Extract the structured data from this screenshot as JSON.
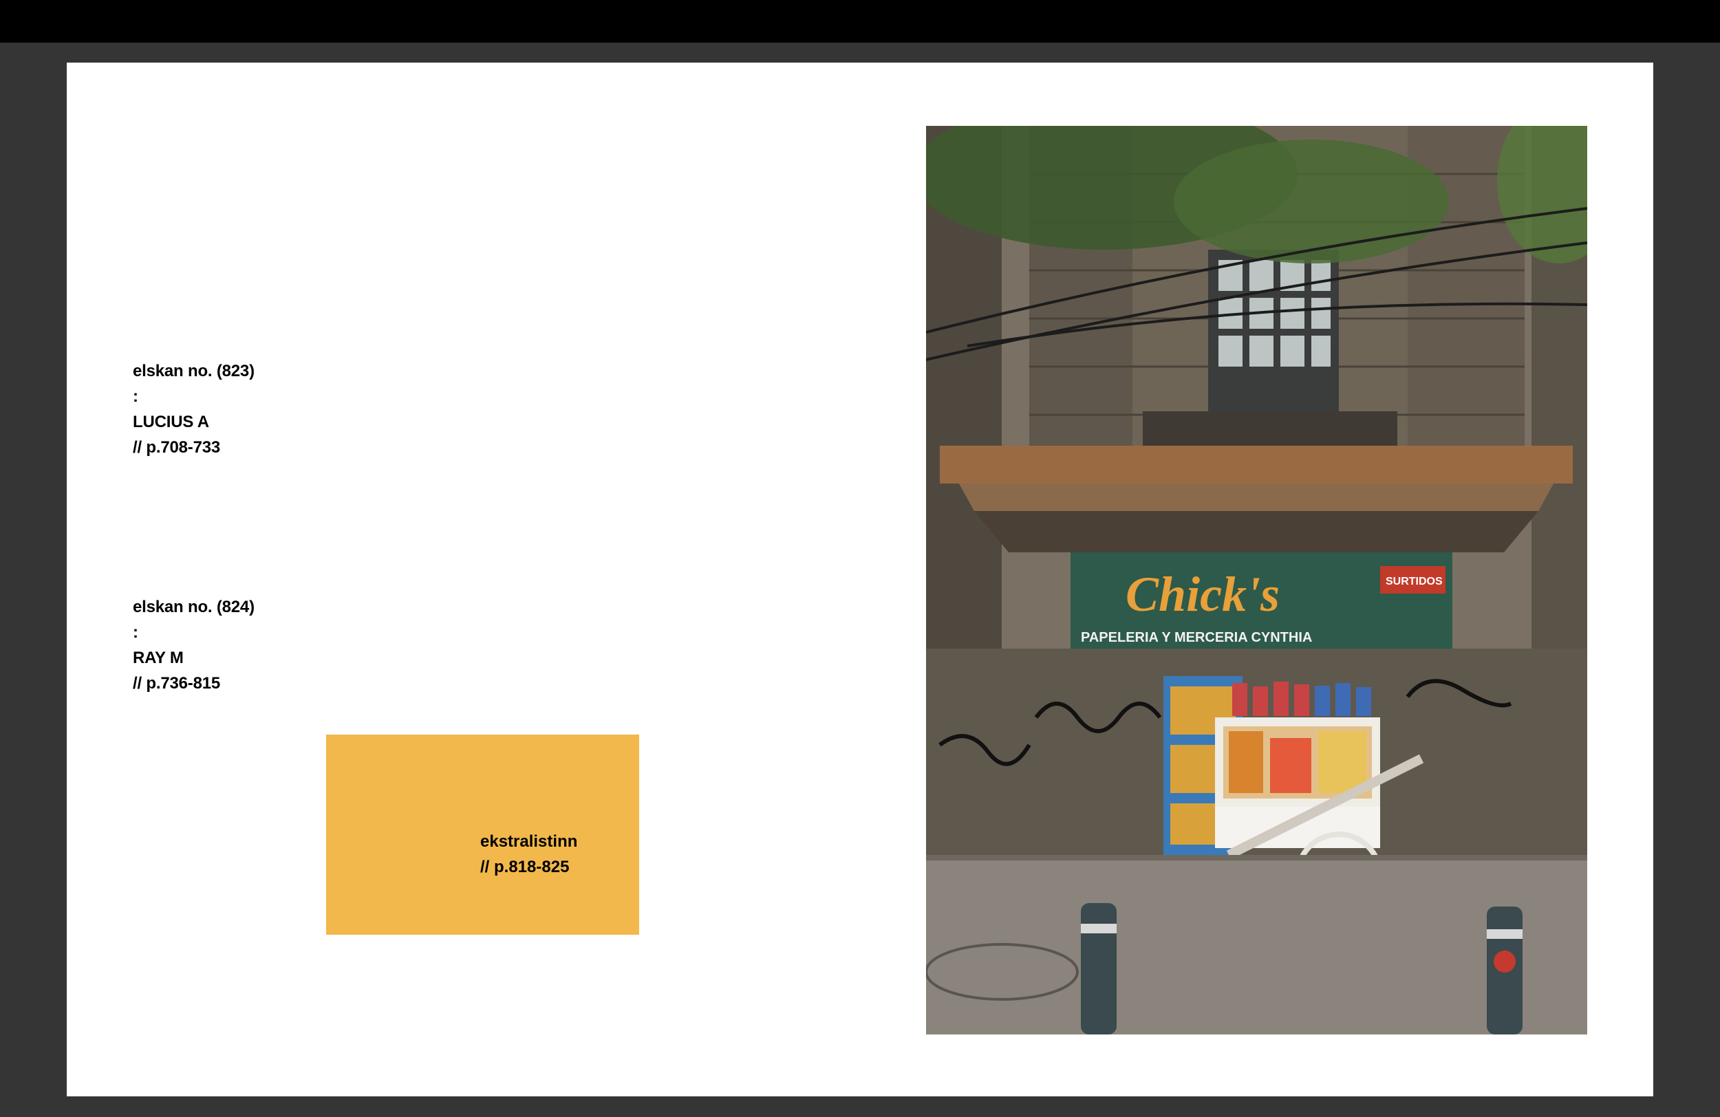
{
  "entries": [
    {
      "line1": "elskan no. (823)",
      "line2": ":",
      "name": "LUCIUS A",
      "pages": "// p.708-733"
    },
    {
      "line1": "elskan no. (824)",
      "line2": ":",
      "name": "RAY M",
      "pages": "// p.736-815"
    }
  ],
  "extra_box": {
    "title": "ekstralistinn",
    "pages": "// p.818-825",
    "color": "#f2b84b"
  },
  "photo": {
    "sign_brand": "Chick's",
    "sign_subtitle": "PAPELERIA Y MERCERIA CYNTHIA",
    "sign_tag": "SURTIDOS"
  }
}
